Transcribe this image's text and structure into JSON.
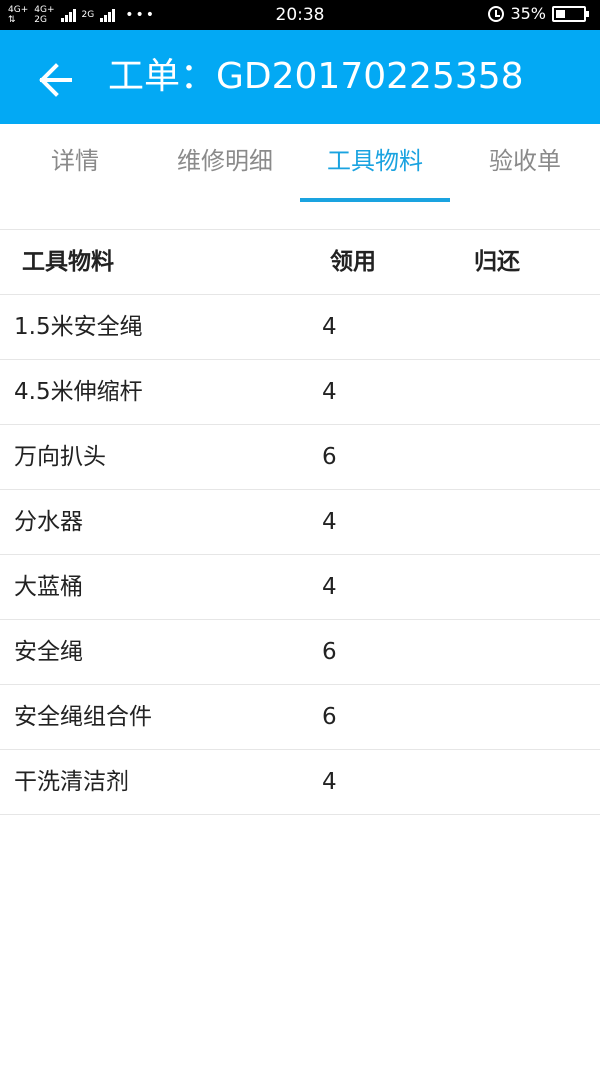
{
  "status_bar": {
    "network_1": [
      "4G+",
      "⇅"
    ],
    "network_2": [
      "4G+",
      "2G"
    ],
    "network_3": [
      "2G",
      ""
    ],
    "dots": "•••",
    "time": "20:38",
    "battery_text": "35%",
    "battery_level": 0.35
  },
  "app_bar": {
    "title": "工单：GD20170225358",
    "color": "#03a9f4"
  },
  "tabs": [
    {
      "label": "详情"
    },
    {
      "label": "维修明细"
    },
    {
      "label": "工具物料"
    },
    {
      "label": "验收单"
    }
  ],
  "active_tab": "工具物料",
  "table": {
    "headers": {
      "name": "工具物料",
      "use": "领用",
      "return": "归还"
    },
    "rows": [
      {
        "name": "1.5米安全绳",
        "use": "4",
        "return": ""
      },
      {
        "name": "4.5米伸缩杆",
        "use": "4",
        "return": ""
      },
      {
        "name": "万向扒头",
        "use": "6",
        "return": ""
      },
      {
        "name": "分水器",
        "use": "4",
        "return": ""
      },
      {
        "name": "大蓝桶",
        "use": "4",
        "return": ""
      },
      {
        "name": "安全绳",
        "use": "6",
        "return": ""
      },
      {
        "name": "安全绳组合件",
        "use": "6",
        "return": ""
      },
      {
        "name": "干洗清洁剂",
        "use": "4",
        "return": ""
      }
    ]
  }
}
